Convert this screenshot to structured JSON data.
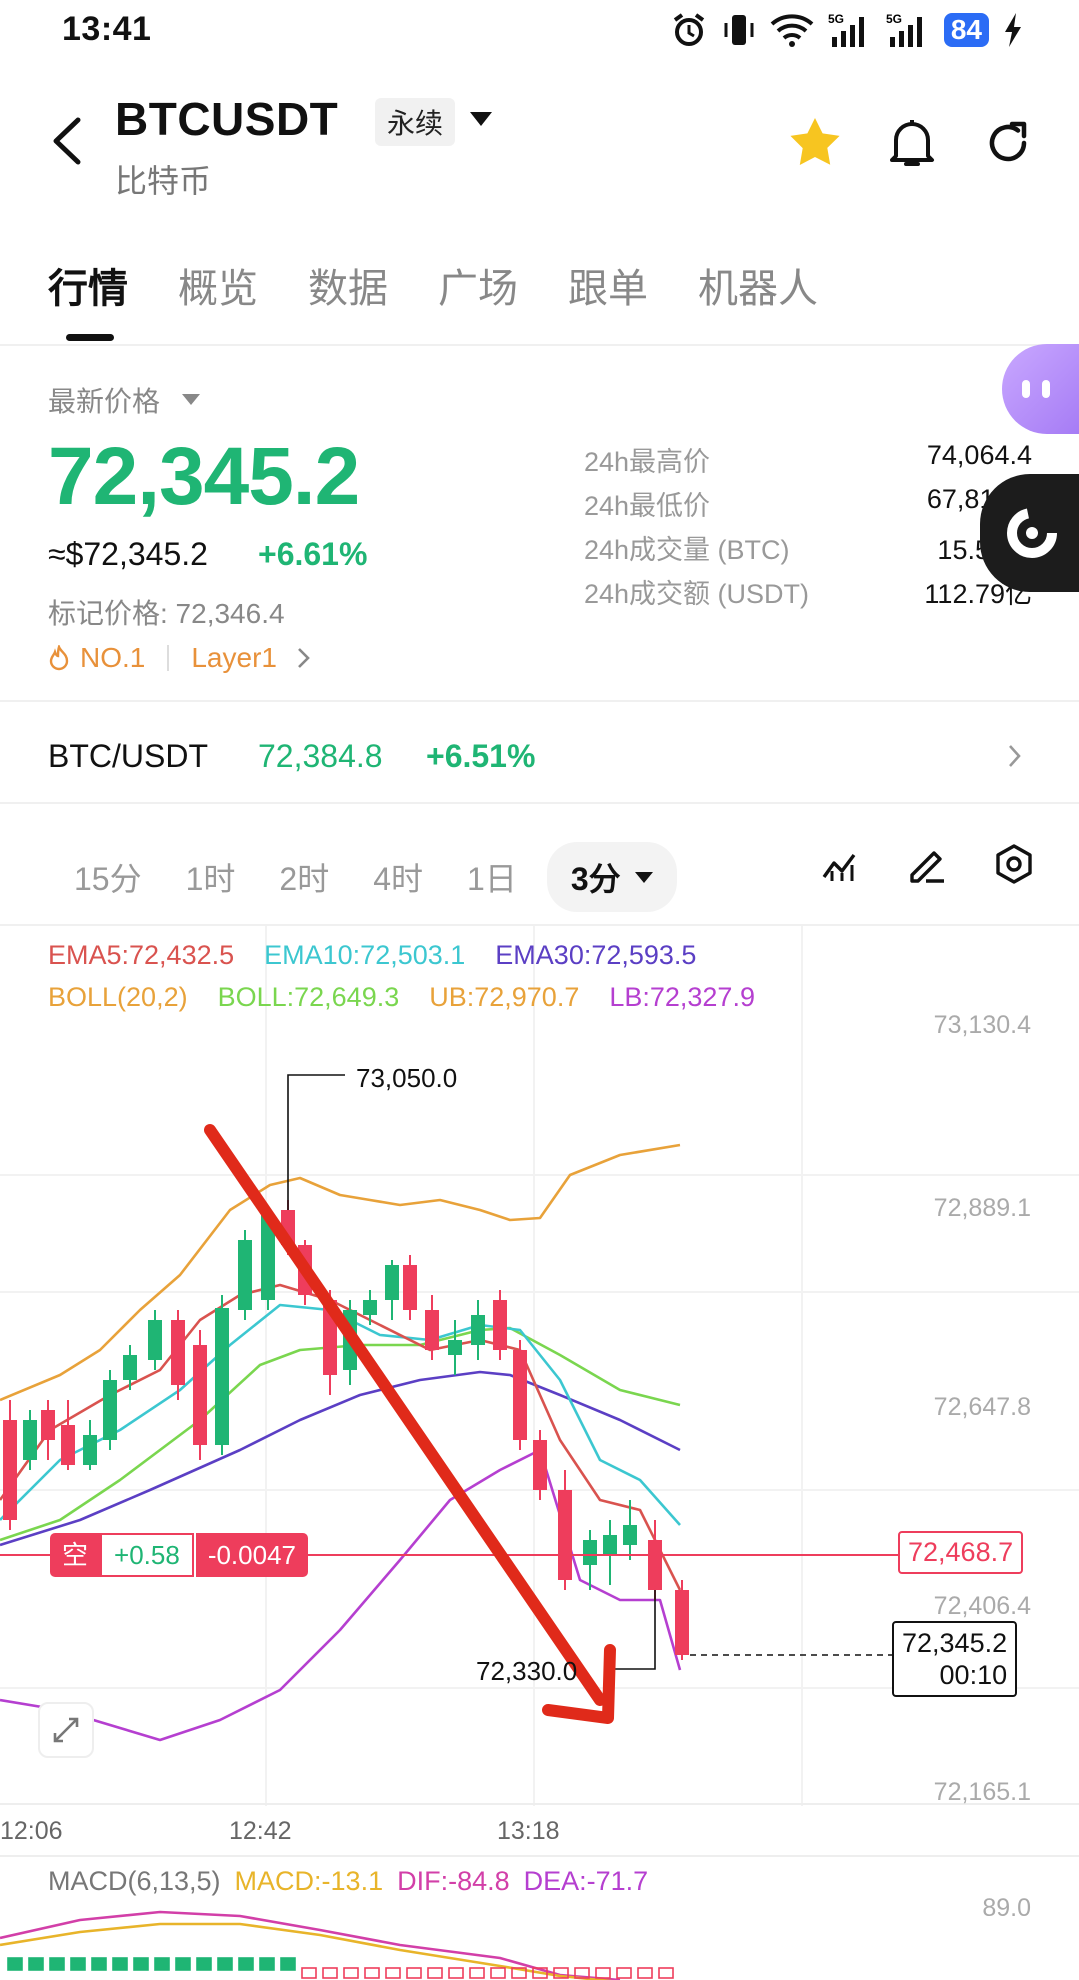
{
  "status_bar": {
    "time": "13:41",
    "battery": "84"
  },
  "header": {
    "symbol": "BTCUSDT",
    "contract_type": "永续",
    "subtitle": "比特币"
  },
  "tabs": [
    {
      "label": "行情",
      "active": true
    },
    {
      "label": "概览"
    },
    {
      "label": "数据"
    },
    {
      "label": "广场"
    },
    {
      "label": "跟单"
    },
    {
      "label": "机器人"
    }
  ],
  "price": {
    "latest_label": "最新价格",
    "last": "72,345.2",
    "usd": "≈$72,345.2",
    "change": "+6.61%",
    "mark": "标记价格: 72,346.4",
    "tag_rank": "NO.1",
    "tag_sector": "Layer1"
  },
  "stats": [
    {
      "label": "24h最高价",
      "value": "74,064.4"
    },
    {
      "label": "24h最低价",
      "value": "67,812.9"
    },
    {
      "label": "24h成交量 (BTC)",
      "value": "15.59万"
    },
    {
      "label": "24h成交额 (USDT)",
      "value": "112.79亿"
    }
  ],
  "spot_pair": {
    "label": "BTC/USDT",
    "price": "72,384.8",
    "change": "+6.51%"
  },
  "timeframes": [
    "15分",
    "1时",
    "2时",
    "4时",
    "1日"
  ],
  "active_timeframe": "3分",
  "indicators": {
    "ema5": "EMA5:72,432.5",
    "ema10": "EMA10:72,503.1",
    "ema30": "EMA30:72,593.5",
    "boll": "BOLL(20,2)",
    "boll_mid": "BOLL:72,649.3",
    "ub": "UB:72,970.7",
    "lb": "LB:72,327.9",
    "macd_title": "MACD(6,13,5)",
    "macd": "MACD:-13.1",
    "dif": "DIF:-84.8",
    "dea": "DEA:-71.7"
  },
  "chart_axis": {
    "y_ticks": [
      "73,130.4",
      "72,889.1",
      "72,647.8",
      "72,406.4",
      "72,165.1"
    ],
    "x_ticks": [
      "12:06",
      "12:42",
      "13:18"
    ],
    "macd_tick": "89.0"
  },
  "chart_annotations": {
    "high_marker": "73,050.0",
    "low_marker": "72,330.0",
    "position_side": "空",
    "position_pnl": "+0.58",
    "position_pct": "-0.0047",
    "position_line_price": "72,468.7",
    "current_price": "72,345.2",
    "countdown": "00:10"
  },
  "colors": {
    "up": "#1fb574",
    "down": "#ee3d5c",
    "ema5": "#d9534f",
    "ema10": "#3cc7d0",
    "ema30": "#5b3fc4",
    "boll": "#e8a23a",
    "boll_mid": "#7ad64f",
    "lb": "#b53fd0",
    "annotation_arrow": "#e02a1a"
  }
}
